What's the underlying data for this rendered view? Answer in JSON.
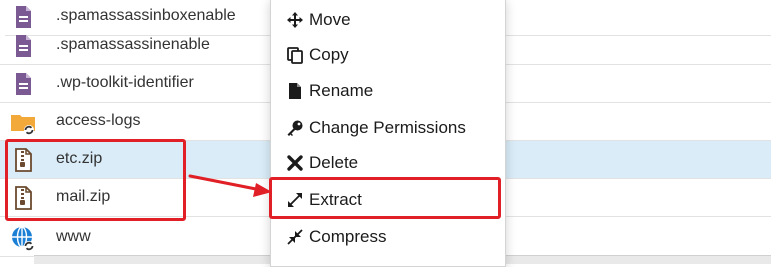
{
  "files": [
    {
      "name": ".spamassassinboxenable",
      "icon": "document-icon"
    },
    {
      "name": ".spamassassinenable",
      "icon": "document-icon"
    },
    {
      "name": ".wp-toolkit-identifier",
      "icon": "document-icon"
    },
    {
      "name": "access-logs",
      "icon": "folder-link-icon"
    },
    {
      "name": "etc.zip",
      "icon": "zip-icon",
      "selected": true
    },
    {
      "name": "mail.zip",
      "icon": "zip-icon"
    },
    {
      "name": "www",
      "icon": "globe-link-icon"
    }
  ],
  "context_menu": {
    "items": [
      {
        "label": "Move",
        "icon": "move-icon"
      },
      {
        "label": "Copy",
        "icon": "copy-icon"
      },
      {
        "label": "Rename",
        "icon": "file-icon"
      },
      {
        "label": "Change Permissions",
        "icon": "key-icon"
      },
      {
        "label": "Delete",
        "icon": "close-icon"
      },
      {
        "label": "Extract",
        "icon": "expand-icon"
      },
      {
        "label": "Compress",
        "icon": "compress-icon"
      }
    ]
  },
  "colors": {
    "selected_row": "#d9ecf8",
    "annotation_red": "#e01f26",
    "doc_icon": "#7b5a93",
    "folder_icon": "#f3a93a",
    "globe_icon": "#1c7fd6"
  }
}
